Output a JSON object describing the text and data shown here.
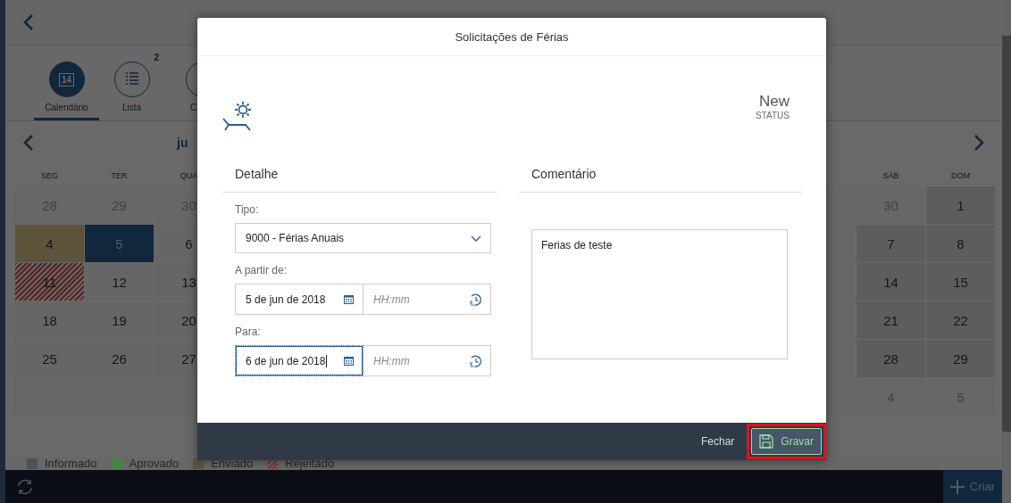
{
  "tabs": [
    {
      "label": "Calendário",
      "kind": "calendar",
      "icon_text": "14",
      "selected": true
    },
    {
      "label": "Lista",
      "kind": "list",
      "badge": "2",
      "selected": false
    },
    {
      "label": "C",
      "kind": "other",
      "selected": false
    }
  ],
  "month": {
    "label": "ju"
  },
  "weekdays": {
    "left": [
      "SEG",
      "TER",
      "QUA"
    ],
    "right": [
      "SÁB",
      "DOM"
    ]
  },
  "weeks": [
    {
      "left": [
        {
          "label": "28",
          "kind": "other_month",
          "selected": false
        },
        {
          "label": "29",
          "kind": "other_month",
          "selected": false
        },
        {
          "label": "30",
          "kind": "other_month",
          "selected": false
        }
      ],
      "right": [
        {
          "label": "30",
          "kind": "other_month",
          "selected": false
        },
        {
          "label": "1",
          "kind": "weekend",
          "selected": false
        }
      ]
    },
    {
      "left": [
        {
          "label": "4",
          "kind": "sent",
          "selected": false
        },
        {
          "label": "5",
          "kind": "workday",
          "selected": true
        },
        {
          "label": "6",
          "kind": "workday",
          "selected": false
        }
      ],
      "right": [
        {
          "label": "7",
          "kind": "weekend",
          "selected": false
        },
        {
          "label": "8",
          "kind": "weekend",
          "selected": false
        }
      ]
    },
    {
      "left": [
        {
          "label": "11",
          "kind": "rejected",
          "selected": false
        },
        {
          "label": "12",
          "kind": "workday",
          "selected": false
        },
        {
          "label": "13",
          "kind": "workday",
          "selected": false
        }
      ],
      "right": [
        {
          "label": "14",
          "kind": "weekend",
          "selected": false
        },
        {
          "label": "15",
          "kind": "weekend",
          "selected": false
        }
      ]
    },
    {
      "left": [
        {
          "label": "18",
          "kind": "workday",
          "selected": false
        },
        {
          "label": "19",
          "kind": "workday",
          "selected": false
        },
        {
          "label": "20",
          "kind": "workday",
          "selected": false
        }
      ],
      "right": [
        {
          "label": "21",
          "kind": "weekend",
          "selected": false
        },
        {
          "label": "22",
          "kind": "weekend",
          "selected": false
        }
      ]
    },
    {
      "left": [
        {
          "label": "25",
          "kind": "workday",
          "selected": false
        },
        {
          "label": "26",
          "kind": "workday",
          "selected": false
        },
        {
          "label": "27",
          "kind": "workday",
          "selected": false
        }
      ],
      "right": [
        {
          "label": "28",
          "kind": "weekend",
          "selected": false
        },
        {
          "label": "29",
          "kind": "weekend",
          "selected": false
        }
      ]
    },
    {
      "right": [
        {
          "label": "4",
          "kind": "other_month",
          "selected": false
        },
        {
          "label": "5",
          "kind": "other_month",
          "selected": false
        }
      ]
    }
  ],
  "legend": [
    {
      "label": "Informado",
      "color": "#47545d",
      "hatched": false
    },
    {
      "label": "Aprovado",
      "color": "#2a9a2a",
      "hatched": true
    },
    {
      "label": "Enviado",
      "color": "#5e5440",
      "hatched": false
    },
    {
      "label": "Rejeitado",
      "color": "#8b3330",
      "hatched": true
    }
  ],
  "create_button": {
    "label": "Criar"
  },
  "dialog": {
    "title": "Solicitações de Férias",
    "status": "New",
    "status_label": "STATUS",
    "detail_heading": "Detalhe",
    "comment_heading": "Comentário",
    "type_label": "Tipo:",
    "type_value": "9000 - Férias Anuais",
    "dates": [
      {
        "label": "A partir de:",
        "date": "5 de jun de 2018",
        "time_placeholder": "HH:mm",
        "focused": false
      },
      {
        "label": "Para:",
        "date": "6 de jun de 2018",
        "time_placeholder": "HH:mm",
        "focused": true
      }
    ],
    "comment": "Ferias de teste",
    "buttons": [
      {
        "label": "Fechar",
        "kind": "text",
        "highlighted": false
      },
      {
        "label": "Gravar",
        "kind": "save",
        "highlighted": true
      }
    ]
  }
}
